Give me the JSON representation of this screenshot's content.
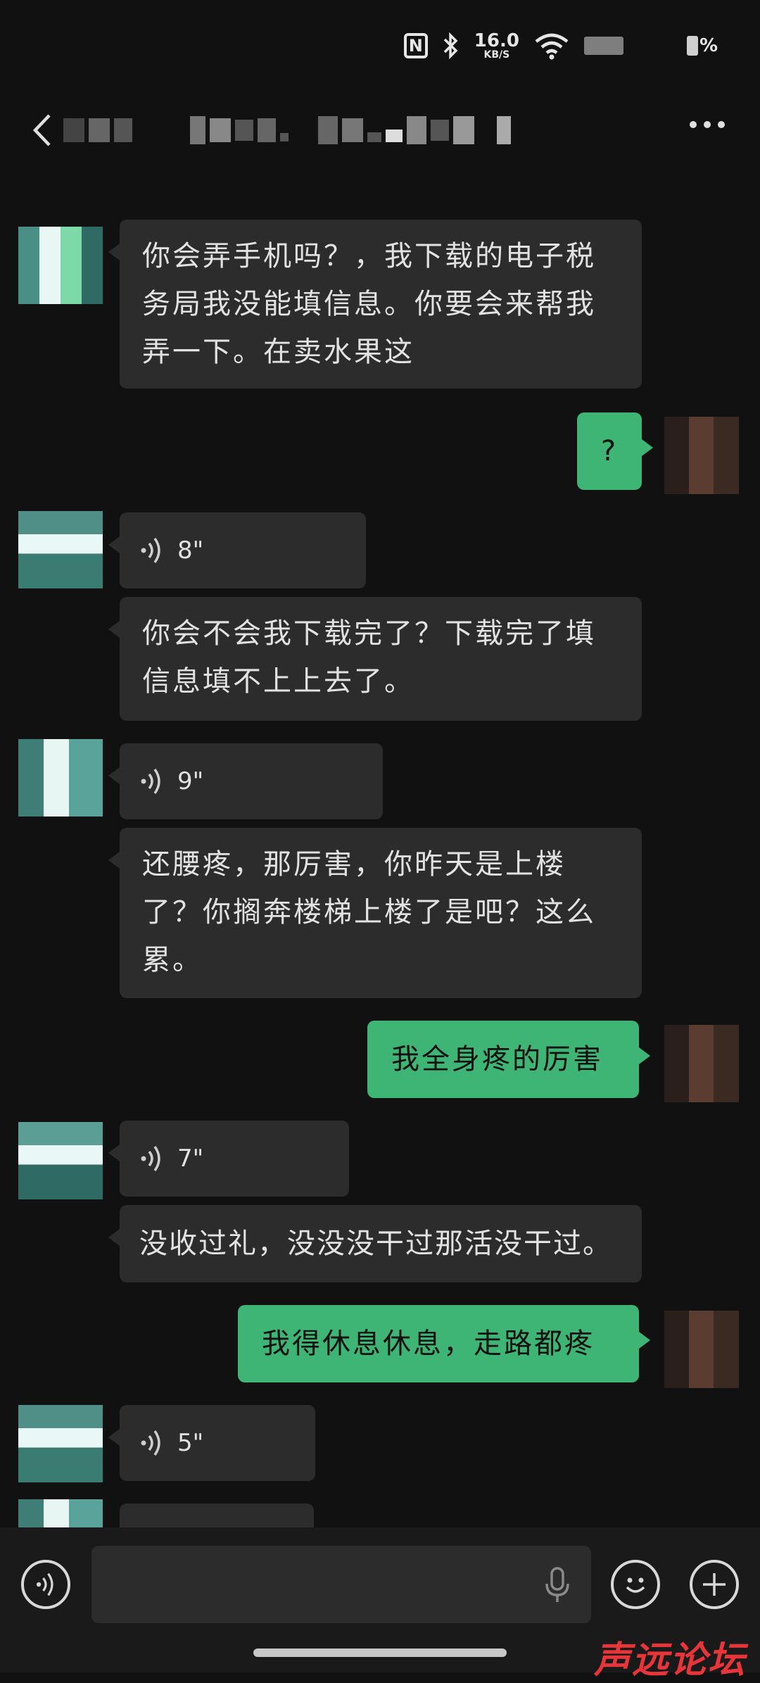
{
  "status_bar": {
    "net_speed_value": "16.0",
    "net_speed_unit": "KB/S",
    "battery_text": "%"
  },
  "header": {
    "back_icon": "chevron-left-icon",
    "more_icon": "more-horizontal-icon"
  },
  "messages": [
    {
      "side": "in",
      "type": "text",
      "text": "你会弄手机吗？，我下载的电子税务局我没能填信息。你要会来帮我弄一下。在卖水果这"
    },
    {
      "side": "out",
      "type": "text",
      "text": "?"
    },
    {
      "side": "in",
      "type": "voice",
      "duration": "8\""
    },
    {
      "side": "in",
      "type": "text",
      "text": "你会不会我下载完了？下载完了填信息填不上上去了。"
    },
    {
      "side": "in",
      "type": "voice",
      "duration": "9\""
    },
    {
      "side": "in",
      "type": "text",
      "text": "还腰疼，那厉害，你昨天是上楼了？你搁奔楼梯上楼了是吧？这么累。"
    },
    {
      "side": "out",
      "type": "text",
      "text": "我全身疼的厉害"
    },
    {
      "side": "in",
      "type": "voice",
      "duration": "7\""
    },
    {
      "side": "in",
      "type": "text",
      "text": "没收过礼，没没没干过那活没干过。"
    },
    {
      "side": "out",
      "type": "text",
      "text": "我得休息休息，走路都疼"
    },
    {
      "side": "in",
      "type": "voice",
      "duration": "5\""
    }
  ],
  "input_bar": {
    "voice_icon": "voice-input-icon",
    "mic_icon": "microphone-icon",
    "emoji_icon": "emoji-icon",
    "add_icon": "plus-icon"
  },
  "watermark": "声远论坛",
  "colors": {
    "background": "#111111",
    "incoming_bubble": "#2c2c2c",
    "outgoing_bubble": "#3eb575"
  }
}
